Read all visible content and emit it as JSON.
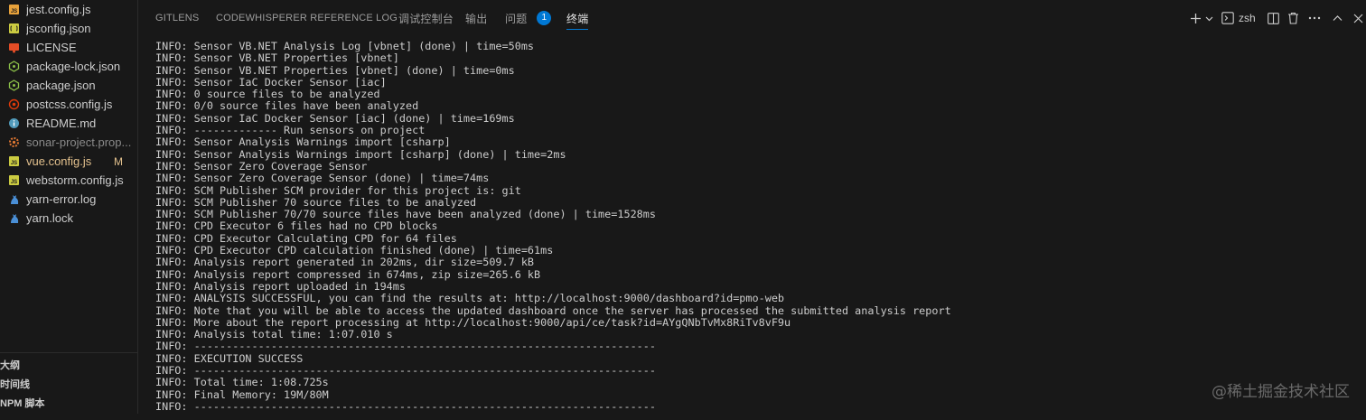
{
  "explorer": {
    "files": [
      {
        "name": "jest.config.js",
        "icon": "js-file-icon",
        "color": "#e8a23b"
      },
      {
        "name": "jsconfig.json",
        "icon": "json-file-icon",
        "color": "#cbcb41"
      },
      {
        "name": "LICENSE",
        "icon": "license-icon",
        "color": "#e44d26"
      },
      {
        "name": "package-lock.json",
        "icon": "npm-package-icon",
        "color": "#8dc149"
      },
      {
        "name": "package.json",
        "icon": "npm-package-icon",
        "color": "#8dc149"
      },
      {
        "name": "postcss.config.js",
        "icon": "postcss-icon",
        "color": "#dd3a0a"
      },
      {
        "name": "README.md",
        "icon": "info-icon",
        "color": "#519aba"
      },
      {
        "name": "sonar-project.prop...",
        "icon": "settings-file-icon",
        "color": "#e37933"
      },
      {
        "name": "vue.config.js",
        "icon": "vue-file-icon",
        "color": "#8dc149",
        "badge": "M"
      },
      {
        "name": "webstorm.config.js",
        "icon": "js-file-icon",
        "color": "#cbcb41"
      },
      {
        "name": "yarn-error.log",
        "icon": "yarn-icon",
        "color": "#4a8fd6"
      },
      {
        "name": "yarn.lock",
        "icon": "yarn-icon",
        "color": "#4a8fd6"
      }
    ],
    "sections": [
      "大纲",
      "时间线",
      "NPM 脚本"
    ]
  },
  "panel": {
    "tabs": [
      {
        "label": "GITLENS"
      },
      {
        "label": "CODEWHISPERER REFERENCE LOG"
      },
      {
        "label": "调试控制台"
      },
      {
        "label": "输出"
      },
      {
        "label": "问题",
        "badge": "1"
      },
      {
        "label": "终端",
        "active": true
      }
    ],
    "actions": {
      "new_terminal": "plus-icon",
      "dropdown": "chevron-down-icon",
      "shell_label": "zsh",
      "shell_icon": "terminal-icon",
      "split": "split-icon",
      "kill": "trash-icon",
      "more": "ellipsis-icon",
      "maximize": "chevron-up-icon",
      "close": "close-icon"
    },
    "accent_color": "#0078d4"
  },
  "terminal": {
    "lines": [
      "INFO: Sensor VB.NET Analysis Log [vbnet] (done) | time=50ms",
      "INFO: Sensor VB.NET Properties [vbnet]",
      "INFO: Sensor VB.NET Properties [vbnet] (done) | time=0ms",
      "INFO: Sensor IaC Docker Sensor [iac]",
      "INFO: 0 source files to be analyzed",
      "INFO: 0/0 source files have been analyzed",
      "INFO: Sensor IaC Docker Sensor [iac] (done) | time=169ms",
      "INFO: ------------- Run sensors on project",
      "INFO: Sensor Analysis Warnings import [csharp]",
      "INFO: Sensor Analysis Warnings import [csharp] (done) | time=2ms",
      "INFO: Sensor Zero Coverage Sensor",
      "INFO: Sensor Zero Coverage Sensor (done) | time=74ms",
      "INFO: SCM Publisher SCM provider for this project is: git",
      "INFO: SCM Publisher 70 source files to be analyzed",
      "INFO: SCM Publisher 70/70 source files have been analyzed (done) | time=1528ms",
      "INFO: CPD Executor 6 files had no CPD blocks",
      "INFO: CPD Executor Calculating CPD for 64 files",
      "INFO: CPD Executor CPD calculation finished (done) | time=61ms",
      "INFO: Analysis report generated in 202ms, dir size=509.7 kB",
      "INFO: Analysis report compressed in 674ms, zip size=265.6 kB",
      "INFO: Analysis report uploaded in 194ms",
      "INFO: ANALYSIS SUCCESSFUL, you can find the results at: http://localhost:9000/dashboard?id=pmo-web",
      "INFO: Note that you will be able to access the updated dashboard once the server has processed the submitted analysis report",
      "INFO: More about the report processing at http://localhost:9000/api/ce/task?id=AYgQNbTvMx8RiTv8vF9u",
      "INFO: Analysis total time: 1:07.010 s",
      "INFO: ------------------------------------------------------------------------",
      "INFO: EXECUTION SUCCESS",
      "INFO: ------------------------------------------------------------------------",
      "INFO: Total time: 1:08.725s",
      "INFO: Final Memory: 19M/80M",
      "INFO: ------------------------------------------------------------------------"
    ]
  },
  "watermark": "@稀土掘金技术社区"
}
